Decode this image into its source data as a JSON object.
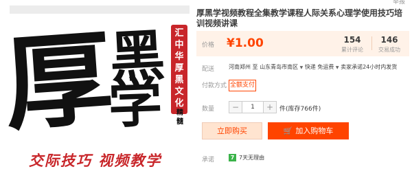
{
  "product_image": {
    "main_chars": [
      "厚",
      "黑",
      "学"
    ],
    "stamp_chars": [
      "汇",
      "中",
      "华",
      "厚",
      "黑",
      "文",
      "化"
    ],
    "side_chars": [
      "精",
      "髓"
    ],
    "slogan": "交际技巧 视频教学"
  },
  "corner_text": "举报",
  "title": "厚黑学视频教程全集教学课程人际关系心理学使用技巧培训视频讲课",
  "price": {
    "label": "价格",
    "value": "¥1.00",
    "reviews_count": "154",
    "reviews_label": "累计评论",
    "sales_count": "146",
    "sales_label": "交易成功"
  },
  "shipping": {
    "label": "配送",
    "from": "河南郑州",
    "to_word": "至",
    "destination": "山东青岛市南区",
    "service": "快递 免运费",
    "promise": "卖家承诺24小时内发货"
  },
  "payment": {
    "label": "付款方式",
    "badge": "全额支付"
  },
  "quantity": {
    "label": "数量",
    "minus": "−",
    "plus": "+",
    "value": "1",
    "unit": "件",
    "stock": "(库存766件)"
  },
  "actions": {
    "buy_now": "立即购买",
    "add_to_cart": "加入购物车"
  },
  "promise": {
    "label": "承诺",
    "icon_char": "7",
    "text": "7天无理由"
  },
  "colors": {
    "accent": "#ff4400",
    "price_bg": "#fff2e8",
    "badge_green": "#3bb34a",
    "stamp_red": "#c8262a"
  }
}
